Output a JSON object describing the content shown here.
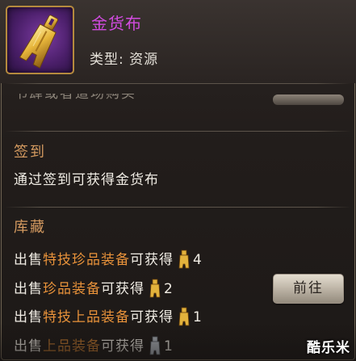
{
  "item": {
    "name": "金货布",
    "type_label": "类型: 资源",
    "icon": "gold-coin-spade-icon"
  },
  "cut_off_text": "书肆或者道场购买",
  "sections": {
    "checkin": {
      "title": "签到",
      "line": "通过签到可获得金货布"
    },
    "storage": {
      "title": "库藏",
      "rows": [
        {
          "prefix": "出售",
          "highlight": "特技珍品装备",
          "suffix": "可获得",
          "coin": "gold",
          "qty": "4"
        },
        {
          "prefix": "出售",
          "highlight": "珍品装备",
          "suffix": "可获得",
          "coin": "gold",
          "qty": "2"
        },
        {
          "prefix": "出售",
          "highlight": "特技上品装备",
          "suffix": "可获得",
          "coin": "gold",
          "qty": "1"
        },
        {
          "prefix": "出售",
          "highlight": "上品装备",
          "suffix": "可获得",
          "coin": "silver",
          "qty": "1"
        }
      ],
      "go_button": "前往"
    }
  },
  "watermark": "酷乐米",
  "colors": {
    "item_name": "#d24be0",
    "section_title": "#d49a60",
    "highlight": "#e8923a",
    "coin_gold": "#e2b23c",
    "coin_silver": "#b9c0c8"
  }
}
